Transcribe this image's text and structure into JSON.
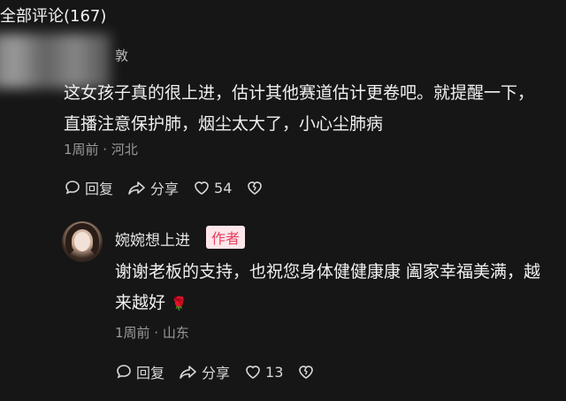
{
  "header": {
    "title": "全部评论(167)"
  },
  "comment": {
    "username": "敦",
    "text": "这女孩子真的很上进，估计其他赛道估计更卷吧。就提醒一下，直播注意保护肺，烟尘太大了，小心尘肺病",
    "time_location": "1周前 · 河北",
    "reply_label": "回复",
    "share_label": "分享",
    "like_count": "54"
  },
  "reply": {
    "username": "婉婉想上进",
    "badge": "作者",
    "text": "谢谢老板的支持，也祝您身体健健康康 阖家幸福美满，越来越好",
    "emoji_icon": "rose-icon",
    "time_location": "1周前 · 山东",
    "reply_label": "回复",
    "share_label": "分享",
    "like_count": "13"
  },
  "colors": {
    "background": "#161616",
    "badge_bg": "#fde6ea",
    "badge_text": "#e8405e"
  }
}
